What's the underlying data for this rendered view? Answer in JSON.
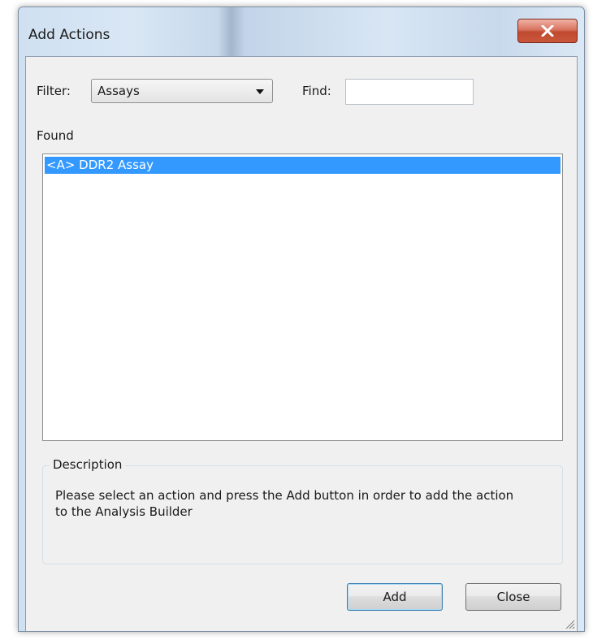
{
  "window": {
    "title": "Add Actions"
  },
  "filter": {
    "label": "Filter:",
    "selected": "Assays"
  },
  "find": {
    "label": "Find:",
    "value": ""
  },
  "found": {
    "label": "Found",
    "items": [
      {
        "label": "<A> DDR2 Assay",
        "selected": true
      }
    ]
  },
  "description": {
    "title": "Description",
    "text_line1": "Please select an action and press the Add button in order to add the action",
    "text_line2": "to the Analysis Builder"
  },
  "buttons": {
    "add": "Add",
    "close": "Close"
  },
  "icons": {
    "close": "close-icon",
    "dropdown": "chevron-down-icon",
    "grip": "resize-grip-icon"
  },
  "colors": {
    "selection": "#3399ff",
    "close_button": "#c9563b"
  }
}
